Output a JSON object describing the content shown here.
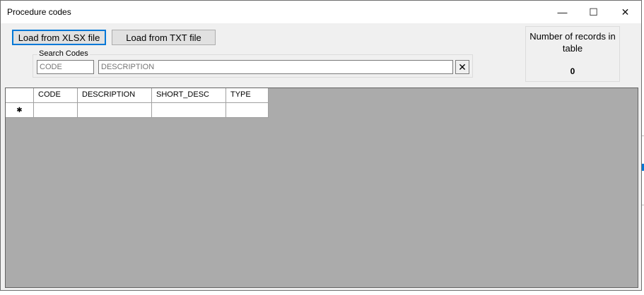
{
  "window": {
    "title": "Procedure codes",
    "minimize_glyph": "—",
    "maximize_glyph": "☐",
    "close_glyph": "✕"
  },
  "toolbar": {
    "load_xlsx_label": "Load from XLSX file",
    "load_txt_label": "Load from TXT file"
  },
  "search": {
    "group_label": "Search Codes",
    "code_placeholder": "CODE",
    "description_placeholder": "DESCRIPTION",
    "clear_glyph": "✕"
  },
  "records": {
    "label": "Number of records in table",
    "count": "0"
  },
  "grid": {
    "columns": [
      "",
      "CODE",
      "DESCRIPTION",
      "SHORT_DESC",
      "TYPE"
    ],
    "new_row_marker": "✱"
  },
  "colors": {
    "accent": "#0078d7",
    "grid_background": "#ababab",
    "window_background": "#f0f0f0"
  }
}
